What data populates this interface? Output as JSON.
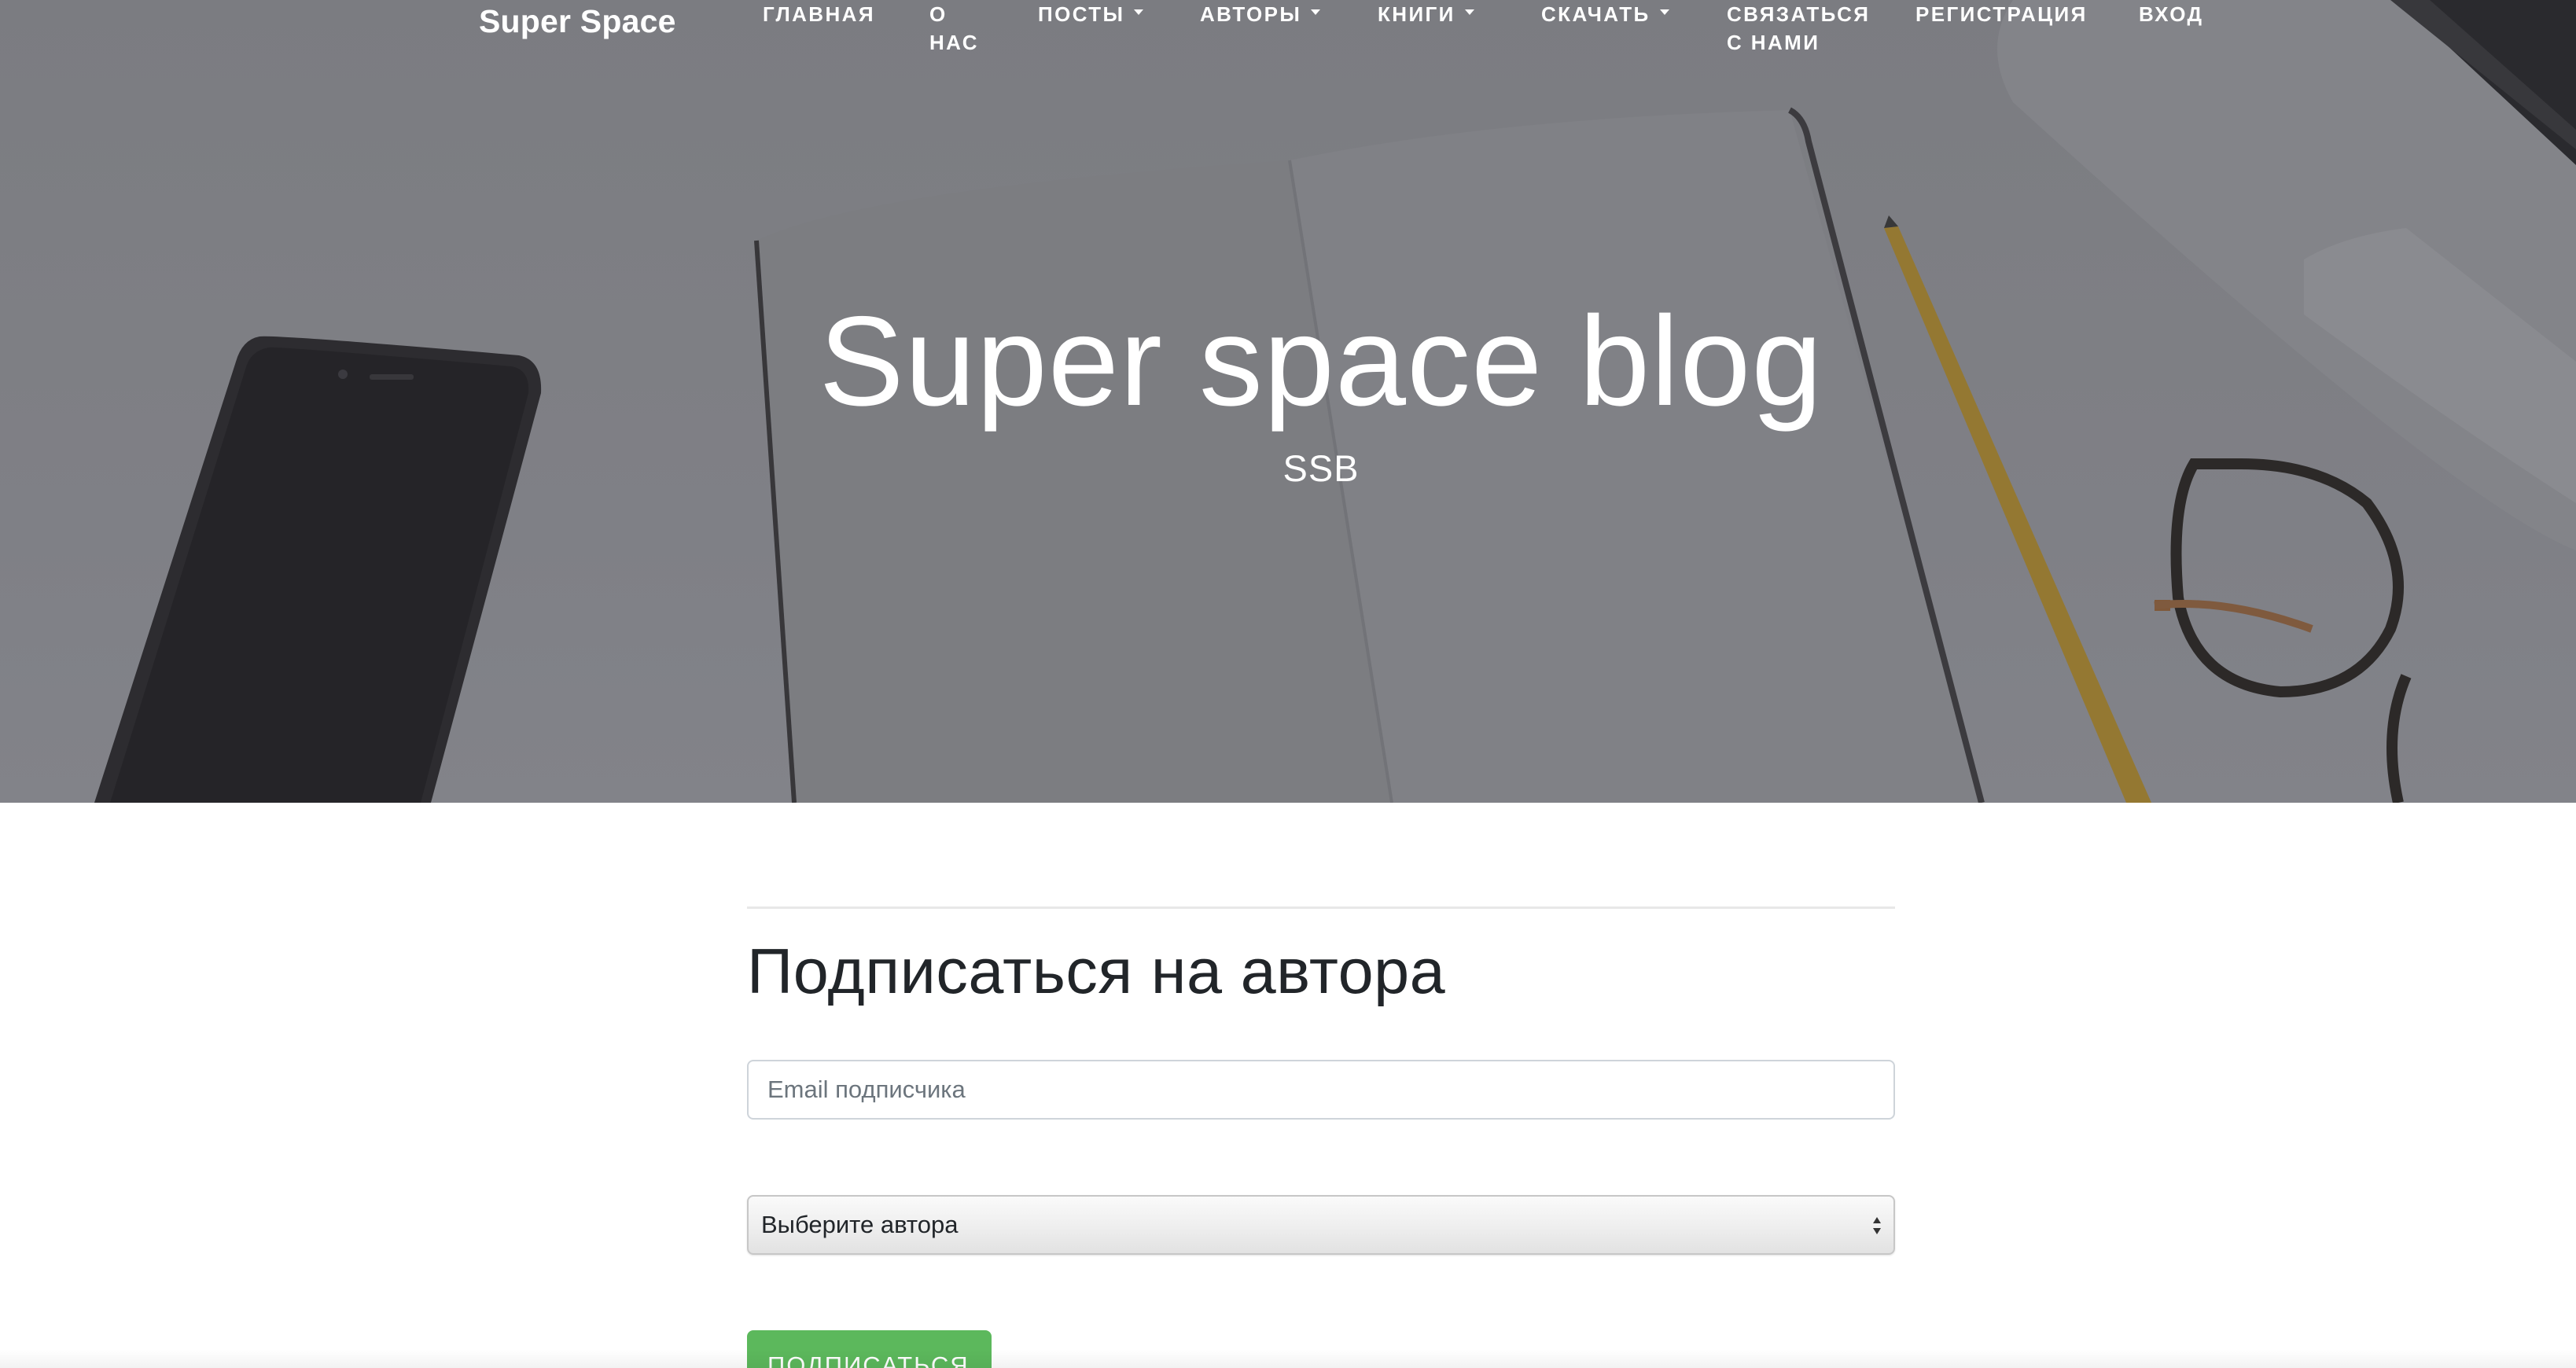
{
  "navbar": {
    "brand": "Super Space",
    "items": [
      {
        "label_lines": [
          "Главная"
        ],
        "dropdown": false
      },
      {
        "label_lines": [
          "О",
          "нас"
        ],
        "dropdown": false
      },
      {
        "label_lines": [
          "Посты"
        ],
        "dropdown": true
      },
      {
        "label_lines": [
          "Авторы"
        ],
        "dropdown": true
      },
      {
        "label_lines": [
          "Книги"
        ],
        "dropdown": true
      },
      {
        "label_lines": [
          "Скачать"
        ],
        "dropdown": true
      },
      {
        "label_lines": [
          "Связаться",
          "с нами"
        ],
        "dropdown": false
      },
      {
        "label_lines": [
          "Регистрация"
        ],
        "dropdown": false
      },
      {
        "label_lines": [
          "Вход"
        ],
        "dropdown": false
      }
    ]
  },
  "hero": {
    "title": "Super space blog",
    "subtitle": "SSB"
  },
  "subscribe_form": {
    "title": "Подписаться на автора",
    "email_placeholder": "Email подписчика",
    "author_select_value": "Выберите автора",
    "submit_label": "Подписаться"
  },
  "colors": {
    "hero_overlay": "#898a8f",
    "button_green": "#5cb85c",
    "text_dark": "#212529"
  },
  "icons": {
    "dropdown_caret": "caret-down-icon",
    "select_arrows": "select-updown-icon"
  }
}
